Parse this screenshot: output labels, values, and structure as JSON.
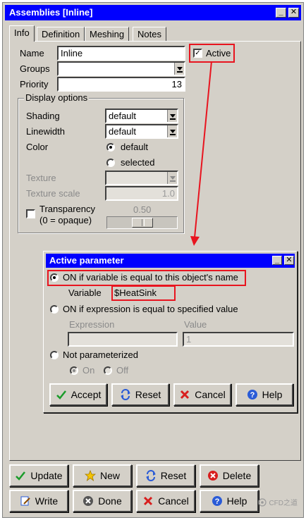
{
  "window": {
    "title": "Assemblies [Inline]",
    "tabs": [
      "Info",
      "Definition",
      "Meshing",
      "Notes"
    ]
  },
  "info": {
    "name_label": "Name",
    "name_value": "Inline",
    "active_label": "Active",
    "active_checked": true,
    "groups_label": "Groups",
    "groups_value": "",
    "priority_label": "Priority",
    "priority_value": "13"
  },
  "display": {
    "title": "Display options",
    "shading_label": "Shading",
    "shading_value": "default",
    "linewidth_label": "Linewidth",
    "linewidth_value": "default",
    "color_label": "Color",
    "color_options": [
      "default",
      "selected"
    ],
    "color_selected": "default",
    "texture_label": "Texture",
    "texture_scale_label": "Texture scale",
    "texture_scale_value": "1.0",
    "transparency_label": "Transparency",
    "transparency_sub": "(0 = opaque)",
    "transparency_value": "0.50",
    "transparency_checked": false
  },
  "active_dialog": {
    "title": "Active parameter",
    "option_name": "ON if variable is equal to this object's name",
    "variable_label": "Variable",
    "variable_value": "$HeatSink",
    "option_expression": "ON if expression is equal to specified value",
    "expression_label": "Expression",
    "expression_value": "",
    "value_label": "Value",
    "value_value": "1",
    "option_none": "Not parameterized",
    "on_label": "On",
    "off_label": "Off",
    "buttons": {
      "accept": "Accept",
      "reset": "Reset",
      "cancel": "Cancel",
      "help": "Help"
    }
  },
  "bottom_buttons": {
    "update": "Update",
    "new": "New",
    "reset": "Reset",
    "delete": "Delete",
    "write": "Write",
    "done": "Done",
    "cancel": "Cancel",
    "help": "Help"
  },
  "watermark": "CFD之道",
  "colors": {
    "titlebar": "#0000ff",
    "highlight": "#e8141f",
    "face": "#d4d0c8"
  }
}
